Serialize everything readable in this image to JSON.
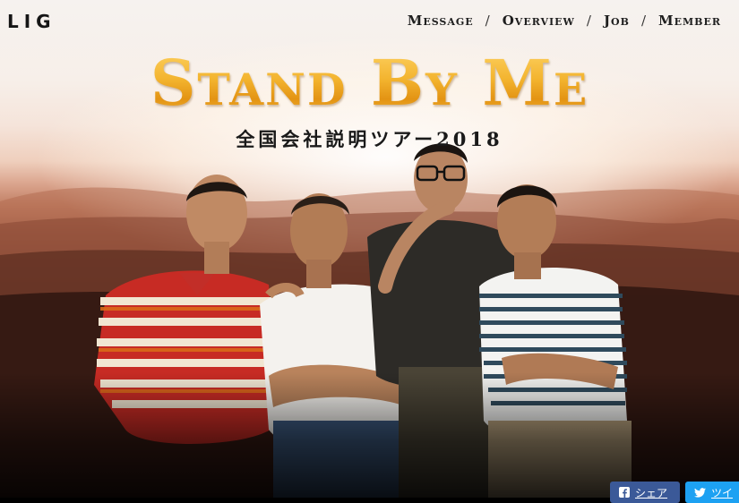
{
  "header": {
    "logo": "LIG",
    "nav": [
      {
        "label": "Message"
      },
      {
        "label": "Overview"
      },
      {
        "label": "Job"
      },
      {
        "label": "Member"
      }
    ],
    "separator": "/"
  },
  "hero": {
    "title": "Stand By Me",
    "subtitle": "全国会社説明ツアー2018"
  },
  "share": {
    "facebook_label": "シェア",
    "twitter_label": "ツイ"
  },
  "colors": {
    "title_gold": "#f3b42f",
    "facebook_blue": "#3b5998",
    "twitter_blue": "#1da1f2"
  }
}
